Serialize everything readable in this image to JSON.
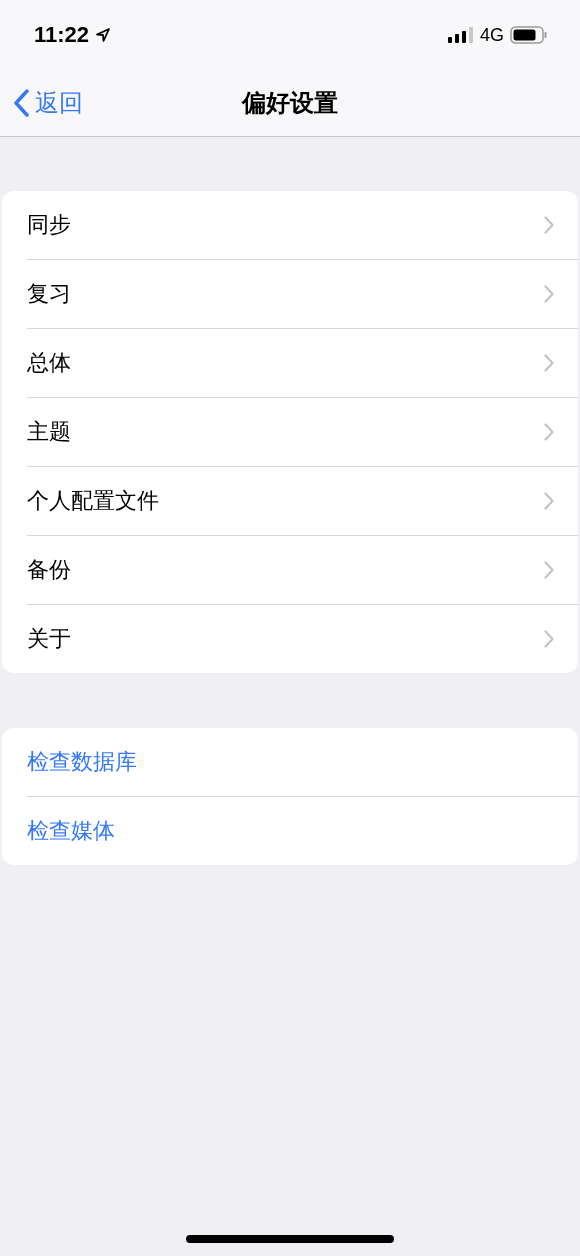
{
  "status_bar": {
    "time": "11:22",
    "network": "4G"
  },
  "nav_bar": {
    "back": "返回",
    "title": "偏好设置"
  },
  "groups": [
    {
      "kind": "navigation",
      "items": [
        "同步",
        "复习",
        "总体",
        "主题",
        "个人配置文件",
        "备份",
        "关于"
      ]
    },
    {
      "kind": "action",
      "items": [
        "检查数据库",
        "检查媒体"
      ]
    }
  ]
}
